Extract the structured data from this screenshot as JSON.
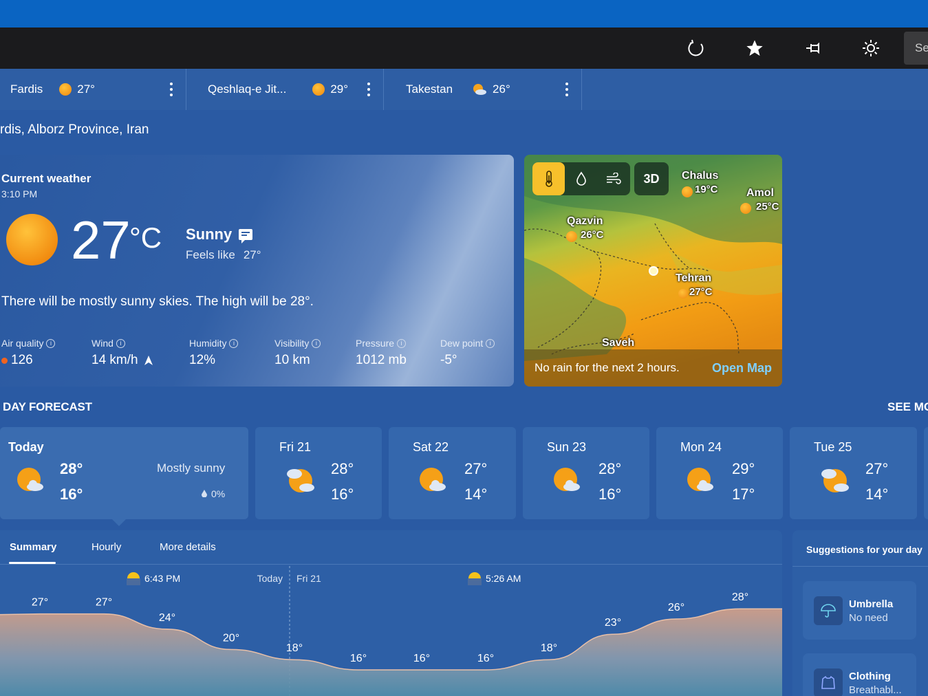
{
  "toolbar": {
    "search_label": "Se"
  },
  "cities": [
    {
      "name": "Fardis",
      "temp": "27°",
      "icon": "sun-icon"
    },
    {
      "name": "Qeshlaq-e Jit...",
      "temp": "29°",
      "icon": "sun-icon"
    },
    {
      "name": "Takestan",
      "temp": "26°",
      "icon": "partly-cloudy-icon"
    }
  ],
  "location": "rdis, Alborz Province, Iran",
  "current": {
    "title": "Current weather",
    "time": "3:10 PM",
    "temp": "27",
    "unit": "°C",
    "condition": "Sunny",
    "feels_label": "Feels like",
    "feels_value": "27°",
    "summary": "There will be mostly sunny skies. The high will be 28°.",
    "metrics": [
      {
        "label": "Air quality",
        "value": "126"
      },
      {
        "label": "Wind",
        "value": "14 km/h"
      },
      {
        "label": "Humidity",
        "value": "12%"
      },
      {
        "label": "Visibility",
        "value": "10 km"
      },
      {
        "label": "Pressure",
        "value": "1012 mb"
      },
      {
        "label": "Dew point",
        "value": "-5°"
      }
    ]
  },
  "map": {
    "toggle_3d": "3D",
    "footer": "No rain for the next 2 hours.",
    "open_label": "Open Map",
    "places": [
      {
        "name": "Chalus",
        "temp": "19°C"
      },
      {
        "name": "Amol",
        "temp": "25°C"
      },
      {
        "name": "Qazvin",
        "temp": "26°C"
      },
      {
        "name": "Tehran",
        "temp": "27°C"
      },
      {
        "name": "Saveh",
        "temp": ""
      }
    ]
  },
  "forecast": {
    "title": "DAY FORECAST",
    "see_more": "SEE MO",
    "today": {
      "name": "Today",
      "hi": "28°",
      "lo": "16°",
      "desc": "Mostly sunny",
      "precip": "0%"
    },
    "days": [
      {
        "name": "Fri 21",
        "hi": "28°",
        "lo": "16°"
      },
      {
        "name": "Sat 22",
        "hi": "27°",
        "lo": "14°"
      },
      {
        "name": "Sun 23",
        "hi": "28°",
        "lo": "16°"
      },
      {
        "name": "Mon 24",
        "hi": "29°",
        "lo": "17°"
      },
      {
        "name": "Tue 25",
        "hi": "27°",
        "lo": "14°"
      }
    ]
  },
  "tabs": [
    "Summary",
    "Hourly",
    "More details"
  ],
  "chart_data": {
    "type": "area",
    "sunset": "6:43 PM",
    "sunrise": "5:26 AM",
    "today_label": "Today",
    "next_day_label": "Fri 21",
    "temps": [
      27,
      27,
      24,
      20,
      18,
      16,
      16,
      16,
      18,
      23,
      26,
      28
    ],
    "temp_labels": [
      "27°",
      "27°",
      "24°",
      "20°",
      "18°",
      "16°",
      "16°",
      "16°",
      "18°",
      "23°",
      "26°",
      "28°"
    ]
  },
  "suggestions": {
    "title": "Suggestions for your day",
    "items": [
      {
        "title": "Umbrella",
        "sub": "No need"
      },
      {
        "title": "Clothing",
        "sub": "Breathabl..."
      }
    ]
  }
}
